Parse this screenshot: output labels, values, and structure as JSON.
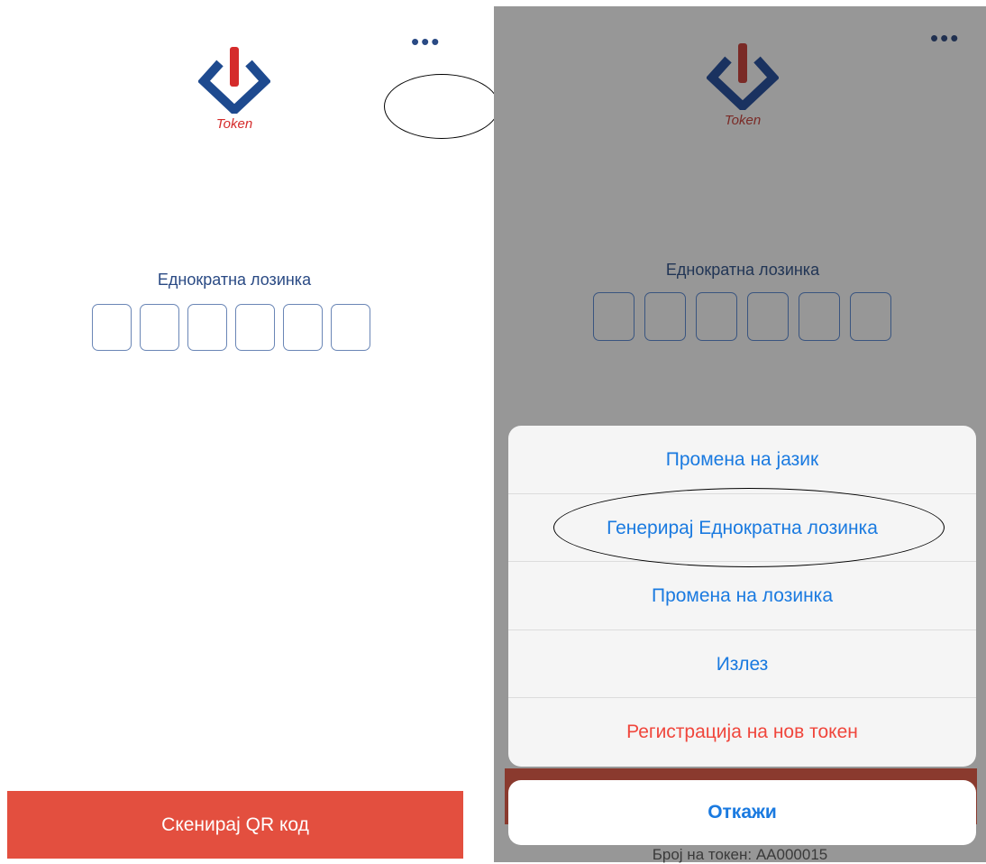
{
  "left_screen": {
    "more_menu": "•••",
    "logo_text": "Token",
    "otp_label": "Еднократна лозинка",
    "otp_digits": [
      "",
      "",
      "",
      "",
      "",
      ""
    ],
    "scan_button": "Скенирај QR код"
  },
  "right_screen": {
    "more_menu": "•••",
    "logo_text": "Token",
    "otp_label": "Еднократна лозинка",
    "otp_digits": [
      "",
      "",
      "",
      "",
      "",
      ""
    ],
    "action_sheet": {
      "items": [
        "Промена на јазик",
        "Генерирај Еднократна лозинка",
        "Промена на лозинка",
        "Излез",
        "Регистрација на нов токен"
      ],
      "cancel": "Откажи"
    },
    "token_number": "Број на токен: AA000015"
  },
  "colors": {
    "brand_blue": "#1e4a8f",
    "brand_red": "#d52b2b",
    "action_blue": "#1a7ae0",
    "danger_red": "#f0463c",
    "scan_button_bg": "#e34f3f"
  }
}
